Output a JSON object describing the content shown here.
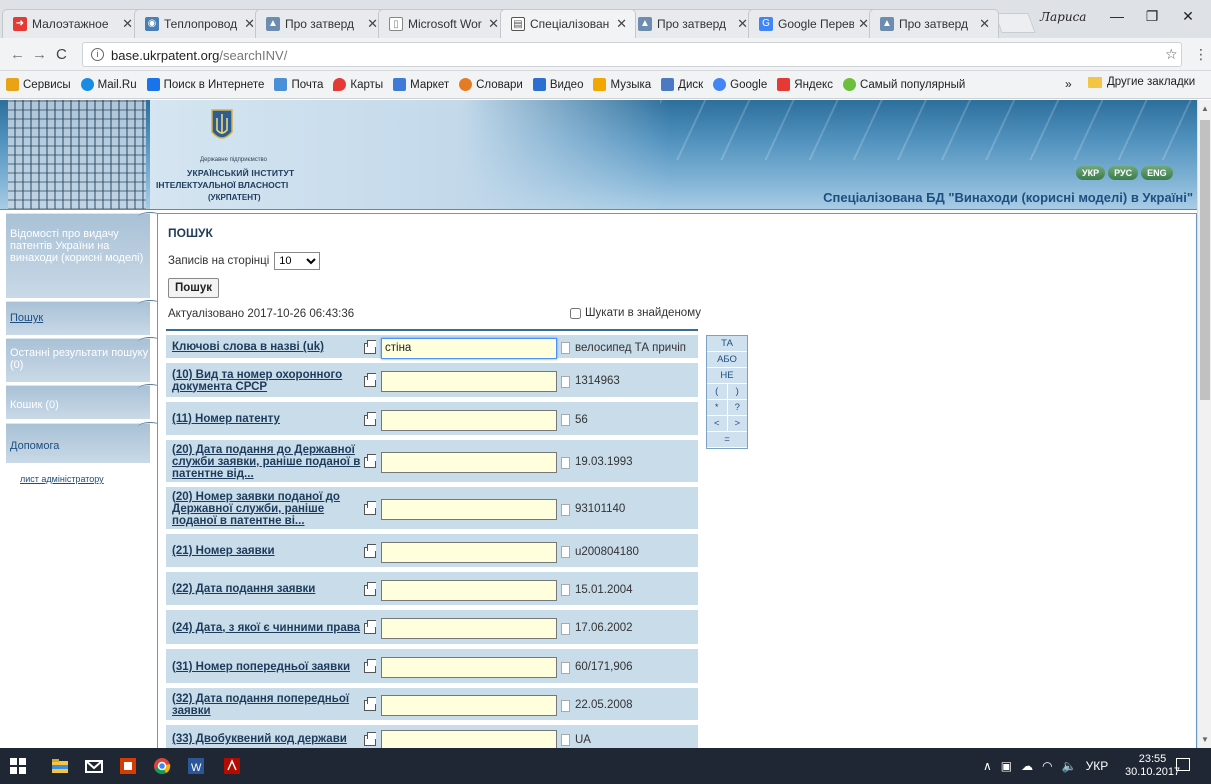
{
  "browser": {
    "tabs": [
      {
        "title": "Малоэтажное",
        "active": false
      },
      {
        "title": "Теплопровод",
        "active": false
      },
      {
        "title": "Про затверд",
        "active": false
      },
      {
        "title": "Microsoft Wor",
        "active": false
      },
      {
        "title": "Спеціалізован",
        "active": true
      },
      {
        "title": "Про затверд",
        "active": false
      },
      {
        "title": "Google Перев",
        "active": false
      },
      {
        "title": "Про затверд",
        "active": false
      }
    ],
    "user_name": "Лариса",
    "url_host": "base.ukrpatent.org",
    "url_path": "/searchINV/"
  },
  "bookmarks": {
    "items": [
      {
        "label": "Сервисы",
        "color": "#e8a317"
      },
      {
        "label": "Mail.Ru",
        "color": "#168de2"
      },
      {
        "label": "Поиск в Интернете",
        "color": "#1a73e8"
      },
      {
        "label": "Почта",
        "color": "#4a90d9"
      },
      {
        "label": "Карты",
        "color": "#e53935"
      },
      {
        "label": "Маркет",
        "color": "#3f7ad8"
      },
      {
        "label": "Словари",
        "color": "#e57c24"
      },
      {
        "label": "Видео",
        "color": "#2a6fd1"
      },
      {
        "label": "Музыка",
        "color": "#f2a600"
      },
      {
        "label": "Диск",
        "color": "#4b79c4"
      },
      {
        "label": "Google",
        "color": "#4285f4"
      },
      {
        "label": "Яндекс",
        "color": "#e53935"
      },
      {
        "label": "Самый популярный",
        "color": "#6bbf3a"
      }
    ],
    "more": "»",
    "other": "Другие закладки"
  },
  "header": {
    "org_line1": "Державне підприємство",
    "org_line2": "УКРАЇНСЬКИЙ ІНСТИТУТ",
    "org_line3": "ІНТЕЛЕКТУАЛЬНОЇ ВЛАСНОСТІ",
    "org_line4": "(УКРПАТЕНТ)",
    "langs": [
      "УКР",
      "РУС",
      "ENG"
    ],
    "db_title": "Спеціалізована БД \"Винаходи (корисні моделі) в Україні\""
  },
  "sidebar": {
    "items": [
      {
        "label": "Відомості про видачу патентів України на винаходи (корисні моделі)"
      },
      {
        "label": "Пошук"
      },
      {
        "label": "Останні результати пошуку (0)"
      },
      {
        "label": "Кошик (0)"
      },
      {
        "label": "Допомога"
      }
    ],
    "admin_link": "лист адміністратору"
  },
  "search": {
    "title": "ПОШУК",
    "per_page_label": "Записів на сторінці",
    "per_page_value": "10",
    "button": "Пошук",
    "updated": "Актуалізовано 2017-10-26 06:43:36",
    "search_in_found": "Шукати в знайденому",
    "fields": [
      {
        "label": "Ключові слова в назві (uk)",
        "value": "стіна",
        "example": "велосипед ТА причіп"
      },
      {
        "label": "(10) Вид та номер охоронного документа СРСР",
        "value": "",
        "example": "1314963"
      },
      {
        "label": "(11) Номер патенту",
        "value": "",
        "example": "56"
      },
      {
        "label": "(20) Дата подання до Державної служби заявки, раніше поданої в патентне від...",
        "value": "",
        "example": "19.03.1993"
      },
      {
        "label": "(20) Номер заявки поданої до Державної служби, раніше поданої в патентне ві...",
        "value": "",
        "example": "93101140"
      },
      {
        "label": "(21) Номер заявки",
        "value": "",
        "example": "u200804180"
      },
      {
        "label": "(22) Дата подання заявки",
        "value": "",
        "example": "15.01.2004"
      },
      {
        "label": "(24) Дата, з якої є чинними права",
        "value": "",
        "example": "17.06.2002"
      },
      {
        "label": "(31) Номер попередньої заявки",
        "value": "",
        "example": "60/171,906"
      },
      {
        "label": "(32) Дата подання попередньої заявки",
        "value": "",
        "example": "22.05.2008"
      },
      {
        "label": "(33) Двобуквений код держави",
        "value": "",
        "example": "UA"
      }
    ],
    "operators": [
      [
        "ТА"
      ],
      [
        "АБО"
      ],
      [
        "НЕ"
      ],
      [
        "(",
        ")"
      ],
      [
        "*",
        "?"
      ],
      [
        "<",
        ">"
      ],
      [
        "="
      ]
    ]
  },
  "taskbar": {
    "lang": "УКР",
    "time": "23:55",
    "date": "30.10.2017"
  }
}
